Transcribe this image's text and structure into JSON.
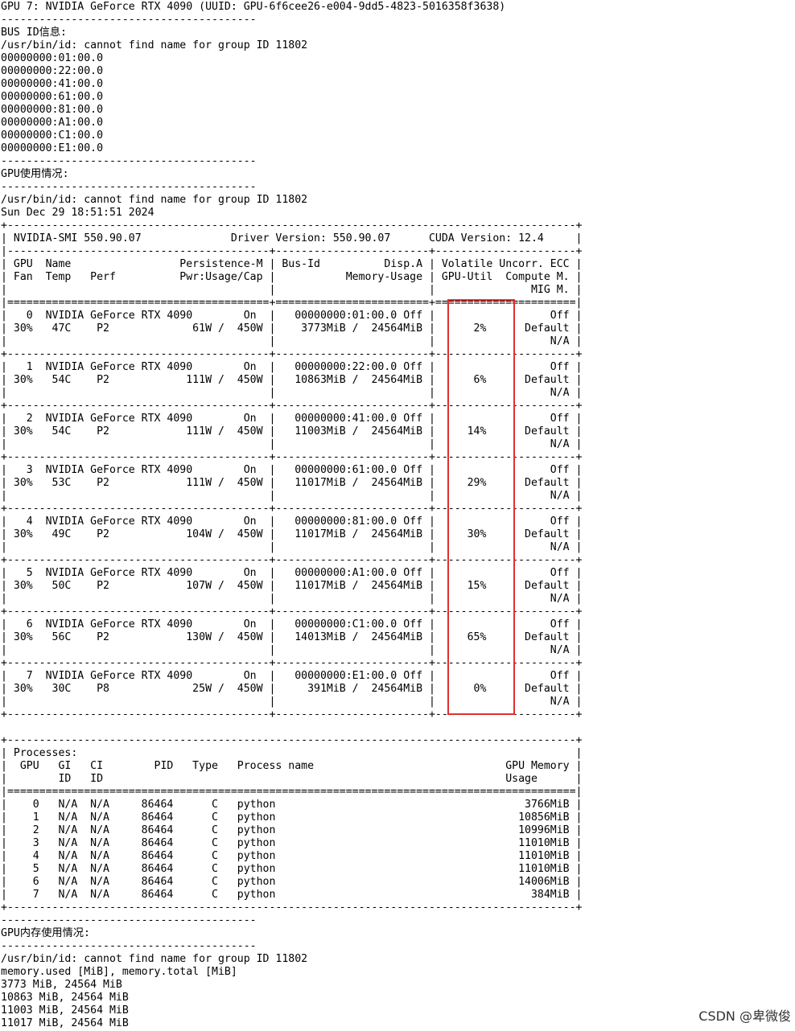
{
  "colors": {
    "background": "#ffffff",
    "text": "#000000",
    "highlight_border": "#e03030",
    "watermark": "#333333"
  },
  "terminal": {
    "lines": [
      "GPU 7: NVIDIA GeForce RTX 4090 (UUID: GPU-6f6cee26-e004-9dd5-4823-5016358f3638)",
      "----------------------------------------",
      "BUS ID信息:",
      "/usr/bin/id: cannot find name for group ID 11802",
      "00000000:01:00.0",
      "00000000:22:00.0",
      "00000000:41:00.0",
      "00000000:61:00.0",
      "00000000:81:00.0",
      "00000000:A1:00.0",
      "00000000:C1:00.0",
      "00000000:E1:00.0",
      "----------------------------------------",
      "GPU使用情况:",
      "----------------------------------------",
      "/usr/bin/id: cannot find name for group ID 11802",
      "Sun Dec 29 18:51:51 2024",
      "+-----------------------------------------------------------------------------------------+",
      "| NVIDIA-SMI 550.90.07              Driver Version: 550.90.07      CUDA Version: 12.4     |",
      "|-----------------------------------------+------------------------+----------------------+",
      "| GPU  Name                 Persistence-M | Bus-Id          Disp.A | Volatile Uncorr. ECC |",
      "| Fan  Temp   Perf          Pwr:Usage/Cap |           Memory-Usage | GPU-Util  Compute M. |",
      "|                                         |                        |               MIG M. |",
      "|=========================================+========================+======================|",
      "|   0  NVIDIA GeForce RTX 4090        On  |   00000000:01:00.0 Off |                  Off |",
      "| 30%   47C    P2             61W /  450W |    3773MiB /  24564MiB |      2%      Default |",
      "|                                         |                        |                  N/A |",
      "+-----------------------------------------+------------------------+----------------------+",
      "|   1  NVIDIA GeForce RTX 4090        On  |   00000000:22:00.0 Off |                  Off |",
      "| 30%   54C    P2            111W /  450W |   10863MiB /  24564MiB |      6%      Default |",
      "|                                         |                        |                  N/A |",
      "+-----------------------------------------+------------------------+----------------------+",
      "|   2  NVIDIA GeForce RTX 4090        On  |   00000000:41:00.0 Off |                  Off |",
      "| 30%   54C    P2            111W /  450W |   11003MiB /  24564MiB |     14%      Default |",
      "|                                         |                        |                  N/A |",
      "+-----------------------------------------+------------------------+----------------------+",
      "|   3  NVIDIA GeForce RTX 4090        On  |   00000000:61:00.0 Off |                  Off |",
      "| 30%   53C    P2            111W /  450W |   11017MiB /  24564MiB |     29%      Default |",
      "|                                         |                        |                  N/A |",
      "+-----------------------------------------+------------------------+----------------------+",
      "|   4  NVIDIA GeForce RTX 4090        On  |   00000000:81:00.0 Off |                  Off |",
      "| 30%   49C    P2            104W /  450W |   11017MiB /  24564MiB |     30%      Default |",
      "|                                         |                        |                  N/A |",
      "+-----------------------------------------+------------------------+----------------------+",
      "|   5  NVIDIA GeForce RTX 4090        On  |   00000000:A1:00.0 Off |                  Off |",
      "| 30%   50C    P2            107W /  450W |   11017MiB /  24564MiB |     15%      Default |",
      "|                                         |                        |                  N/A |",
      "+-----------------------------------------+------------------------+----------------------+",
      "|   6  NVIDIA GeForce RTX 4090        On  |   00000000:C1:00.0 Off |                  Off |",
      "| 30%   56C    P2            130W /  450W |   14013MiB /  24564MiB |     65%      Default |",
      "|                                         |                        |                  N/A |",
      "+-----------------------------------------+------------------------+----------------------+",
      "|   7  NVIDIA GeForce RTX 4090        On  |   00000000:E1:00.0 Off |                  Off |",
      "| 30%   30C    P8             25W /  450W |     391MiB /  24564MiB |      0%      Default |",
      "|                                         |                        |                  N/A |",
      "+-----------------------------------------+------------------------+----------------------+",
      "",
      "+-----------------------------------------------------------------------------------------+",
      "| Processes:                                                                              |",
      "|  GPU   GI   CI        PID   Type   Process name                              GPU Memory |",
      "|        ID   ID                                                               Usage      |",
      "|=========================================================================================|",
      "|    0   N/A  N/A     86464      C   python                                       3766MiB |",
      "|    1   N/A  N/A     86464      C   python                                      10856MiB |",
      "|    2   N/A  N/A     86464      C   python                                      10996MiB |",
      "|    3   N/A  N/A     86464      C   python                                      11010MiB |",
      "|    4   N/A  N/A     86464      C   python                                      11010MiB |",
      "|    5   N/A  N/A     86464      C   python                                      11010MiB |",
      "|    6   N/A  N/A     86464      C   python                                      14006MiB |",
      "|    7   N/A  N/A     86464      C   python                                        384MiB |",
      "+-----------------------------------------------------------------------------------------+",
      "----------------------------------------",
      "GPU内存使用情况:",
      "----------------------------------------",
      "/usr/bin/id: cannot find name for group ID 11802",
      "memory.used [MiB], memory.total [MiB]",
      "3773 MiB, 24564 MiB",
      "10863 MiB, 24564 MiB",
      "11003 MiB, 24564 MiB",
      "11017 MiB, 24564 MiB"
    ]
  },
  "watermark": {
    "text": "CSDN @卑微俊"
  }
}
